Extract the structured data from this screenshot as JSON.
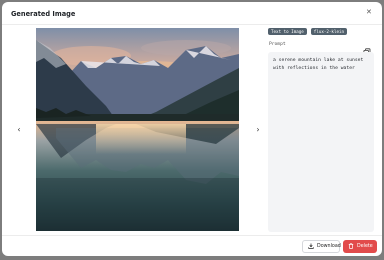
{
  "dialog": {
    "title": "Generated Image",
    "close_icon": "close-icon"
  },
  "image": {
    "alt": "Mountain lake at sunset with reflections",
    "nav_prev_icon": "chevron-left-icon",
    "nav_next_icon": "chevron-right-icon"
  },
  "tags": [
    "Text to Image",
    "flux-2-klein"
  ],
  "prompt": {
    "label": "Prompt",
    "text": "a serene mountain lake at sunset with reflections in the water",
    "copy_icon": "copy-icon"
  },
  "actions": {
    "download_label": "Download",
    "delete_label": "Delete",
    "delete_color": "#e24b4b"
  },
  "colors": {
    "tag_bg": "#51606c",
    "prompt_bg": "#f3f4f6"
  }
}
